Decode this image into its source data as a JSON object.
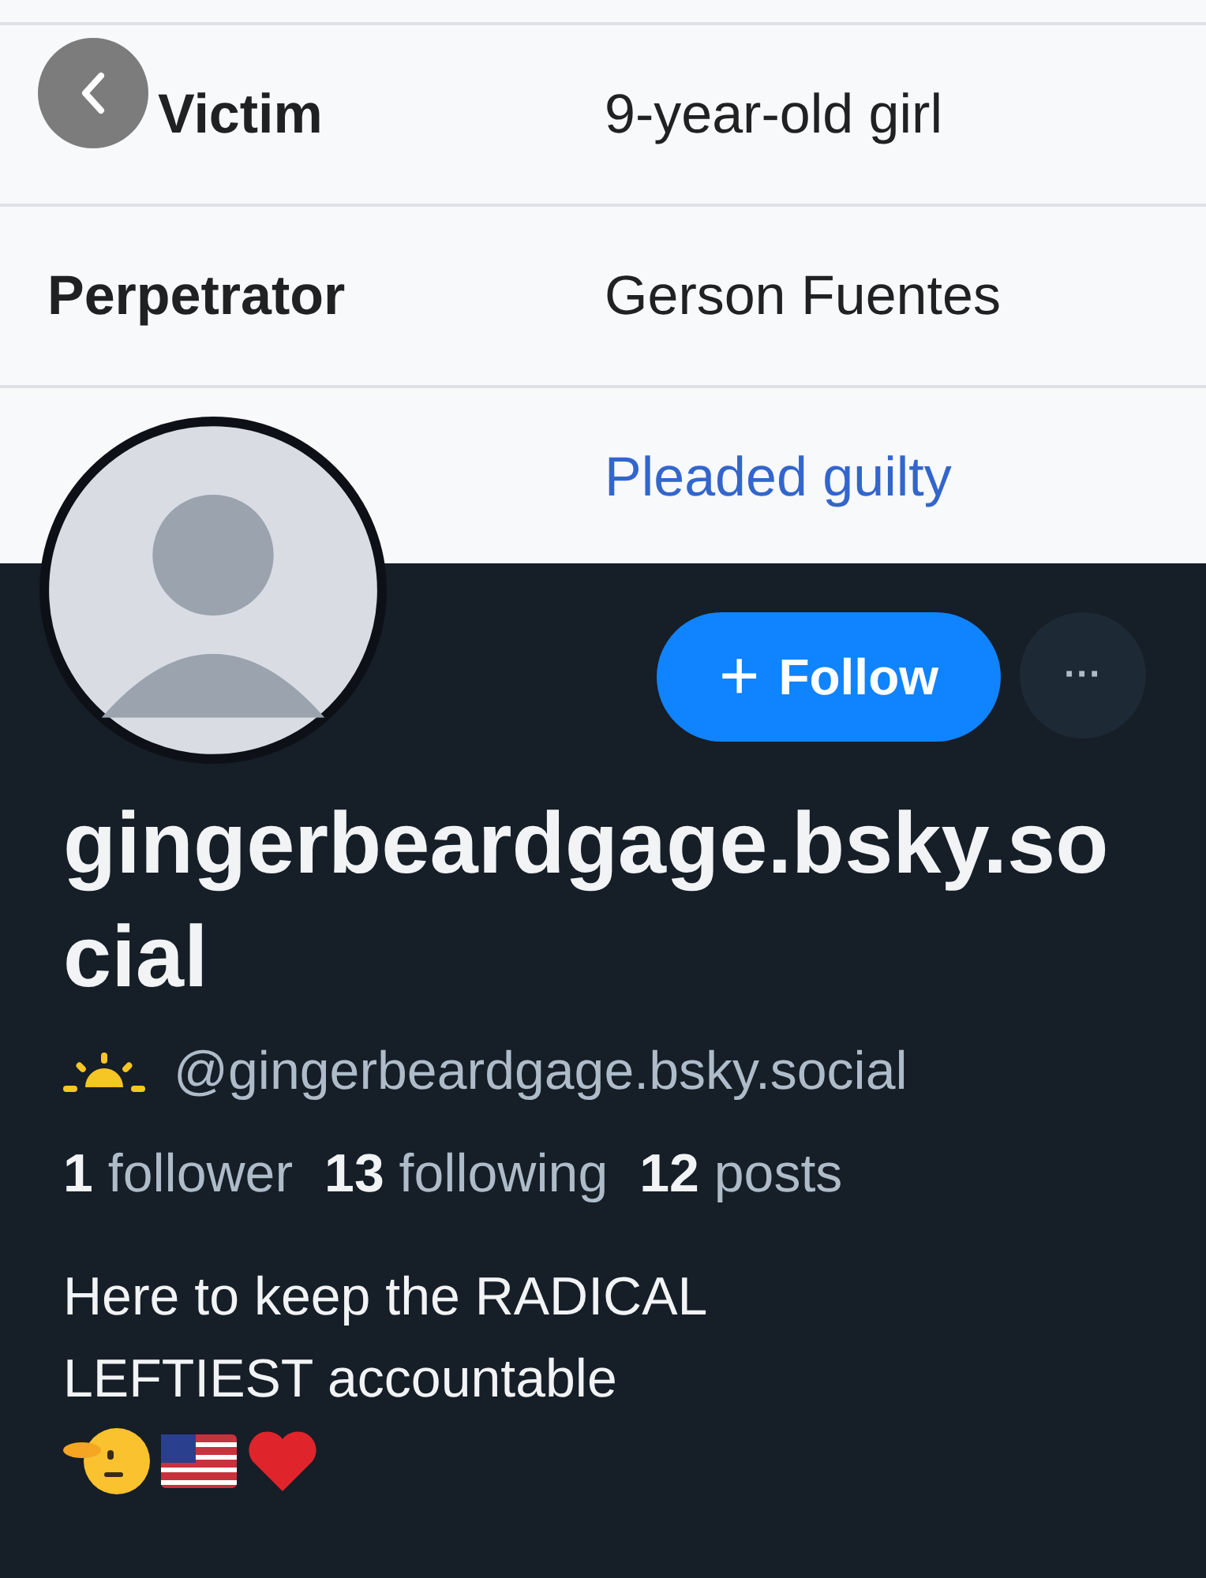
{
  "banner": {
    "kind": "table",
    "rows": [
      {
        "label": "Victim",
        "value": "9-year-old girl",
        "link": false
      },
      {
        "label": "Perpetrator",
        "value": "Gerson Fuentes",
        "link": false
      },
      {
        "value": "Pleaded guilty",
        "link": true
      }
    ]
  },
  "profile": {
    "follow_button": "Follow",
    "follow_icon": "+",
    "more_icon": "···",
    "display_name": "gingerbeardgage.bsky.social",
    "handle": "@gingerbeardgage.bsky.social",
    "stats": [
      {
        "count": "1",
        "label": "follower"
      },
      {
        "count": "13",
        "label": "following"
      },
      {
        "count": "12",
        "label": "posts"
      }
    ],
    "bio": [
      "Here to keep the RADICAL",
      "LEFTIEST accountable"
    ]
  }
}
